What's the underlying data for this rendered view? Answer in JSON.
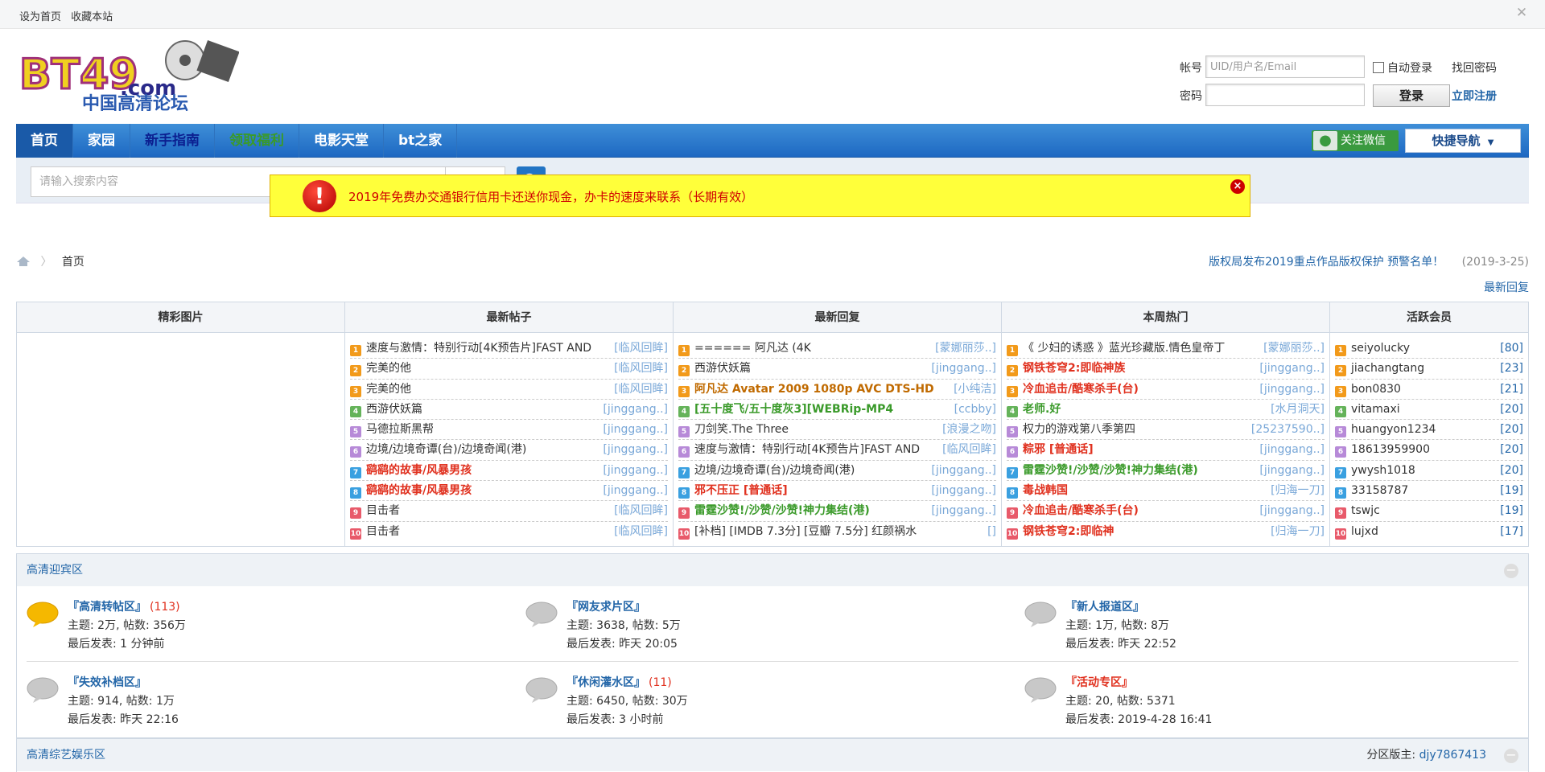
{
  "topbar": {
    "set_home": "设为首页",
    "bookmark": "收藏本站"
  },
  "logo": {
    "text": "BT49",
    "domain": ".com",
    "subtitle": "中国高清论坛"
  },
  "login": {
    "account_label": "帐号",
    "account_placeholder": "UID/用户名/Email",
    "auto_login": "自动登录",
    "find_password": "找回密码",
    "password_label": "密码",
    "login_button": "登录",
    "register": "立即注册"
  },
  "nav": {
    "items": [
      "首页",
      "家园",
      "新手指南",
      "领取福利",
      "电影天堂",
      "bt之家"
    ],
    "wechat": "关注微信",
    "quick_nav": "快捷导航"
  },
  "search": {
    "placeholder": "请输入搜索内容",
    "type": "搜索"
  },
  "notice": {
    "text": "2019年免费办交通银行信用卡还送你现金，办卡的速度来联系（长期有效）",
    "color": "#d00000",
    "background": "#ffff3a"
  },
  "breadcrumb": {
    "home": "首页"
  },
  "announcement": {
    "text": "版权局发布2019重点作品版权保护 预警名单！",
    "date": "(2019-3-25)"
  },
  "latest_reply_link": "最新回复",
  "grid": {
    "headers": [
      "精彩图片",
      "最新帖子",
      "最新回复",
      "本周热门",
      "活跃会员"
    ],
    "rank_colors": [
      "#f29a1a",
      "#f29a1a",
      "#f29a1a",
      "#65b35a",
      "#b78ad8",
      "#b78ad8",
      "#3aa0e0",
      "#3aa0e0",
      "#e85a6a",
      "#e85a6a"
    ],
    "new_posts": [
      {
        "title": "速度与激情：特别行动[4K预告片]FAST AND",
        "author": "[临风回眸]",
        "style": ""
      },
      {
        "title": "完美的他",
        "author": "[临风回眸]",
        "style": ""
      },
      {
        "title": "完美的他",
        "author": "[临风回眸]",
        "style": ""
      },
      {
        "title": "西游伏妖篇",
        "author": "[jinggang..]",
        "style": ""
      },
      {
        "title": "马德拉斯黑帮",
        "author": "[jinggang..]",
        "style": ""
      },
      {
        "title": "边境/边境奇谭(台)/边境奇闻(港)",
        "author": "[jinggang..]",
        "style": ""
      },
      {
        "title": "鹞鹞的故事/风暴男孩",
        "author": "[jinggang..]",
        "style": "red"
      },
      {
        "title": "鹞鹞的故事/风暴男孩",
        "author": "[jinggang..]",
        "style": "red"
      },
      {
        "title": "目击者",
        "author": "[临风回眸]",
        "style": ""
      },
      {
        "title": "目击者",
        "author": "[临风回眸]",
        "style": ""
      }
    ],
    "new_replies": [
      {
        "title": "====== 阿凡达 (4K",
        "author": "[蒙娜丽莎..]",
        "style": ""
      },
      {
        "title": "西游伏妖篇",
        "author": "[jinggang..]",
        "style": ""
      },
      {
        "title": "阿凡达 Avatar 2009 1080p AVC DTS-HD",
        "author": "[小纯洁]",
        "style": "brown"
      },
      {
        "title": "[五十度飞/五十度灰3][WEBRip-MP4",
        "author": "[ccbby]",
        "style": "green"
      },
      {
        "title": "刀剑笑.The Three",
        "author": "[浪漫之吻]",
        "style": ""
      },
      {
        "title": "速度与激情：特别行动[4K预告片]FAST AND",
        "author": "[临风回眸]",
        "style": ""
      },
      {
        "title": "边境/边境奇谭(台)/边境奇闻(港)",
        "author": "[jinggang..]",
        "style": ""
      },
      {
        "title": "邪不压正 [普通话]",
        "author": "[jinggang..]",
        "style": "red"
      },
      {
        "title": "雷霆沙赞!/沙赞/沙赞!神力集结(港)",
        "author": "[jinggang..]",
        "style": "green"
      },
      {
        "title": "[补档] [IMDB 7.3分] [豆瓣 7.5分] 红颜祸水",
        "author": "[]",
        "style": ""
      }
    ],
    "weekly_hot": [
      {
        "title": "《 少妇的诱惑 》蓝光珍藏版.情色皇帝丁",
        "author": "[蒙娜丽莎..]",
        "style": ""
      },
      {
        "title": "钢铁苍穹2:即临神族",
        "author": "[jinggang..]",
        "style": "red"
      },
      {
        "title": "冷血追击/酷寒杀手(台)",
        "author": "[jinggang..]",
        "style": "red"
      },
      {
        "title": "老师.好",
        "author": "[水月洞天]",
        "style": "green"
      },
      {
        "title": "权力的游戏第八季第四",
        "author": "[25237590..]",
        "style": ""
      },
      {
        "title": "粽邪 [普通话]",
        "author": "[jinggang..]",
        "style": "red"
      },
      {
        "title": "雷霆沙赞!/沙赞/沙赞!神力集结(港)",
        "author": "[jinggang..]",
        "style": "green"
      },
      {
        "title": "毒战韩国",
        "author": "[归海一刀]",
        "style": "red"
      },
      {
        "title": "冷血追击/酷寒杀手(台)",
        "author": "[jinggang..]",
        "style": "red"
      },
      {
        "title": "钢铁苍穹2:即临神",
        "author": "[归海一刀]",
        "style": "red"
      }
    ],
    "active_members": [
      {
        "name": "seiyolucky",
        "count": "[80]"
      },
      {
        "name": "jiachangtang",
        "count": "[23]"
      },
      {
        "name": "bon0830",
        "count": "[21]"
      },
      {
        "name": "vitamaxi",
        "count": "[20]"
      },
      {
        "name": "huangyon1234",
        "count": "[20]"
      },
      {
        "name": "18613959900",
        "count": "[20]"
      },
      {
        "name": "ywysh1018",
        "count": "[20]"
      },
      {
        "name": "33158787",
        "count": "[19]"
      },
      {
        "name": "tswjc",
        "count": "[19]"
      },
      {
        "name": "lujxd",
        "count": "[17]"
      }
    ]
  },
  "section1": {
    "title": "高清迎宾区",
    "forums": [
      {
        "name": "『高清转帖区』",
        "count": "(113)",
        "stats": "主题: 2万, 帖数: 356万",
        "last": "最后发表: 1 分钟前",
        "new": true,
        "red": false
      },
      {
        "name": "『网友求片区』",
        "count": "",
        "stats": "主题: 3638, 帖数: 5万",
        "last": "最后发表: 昨天 20:05",
        "new": false,
        "red": false
      },
      {
        "name": "『新人报道区』",
        "count": "",
        "stats": "主题: 1万, 帖数: 8万",
        "last": "最后发表: 昨天 22:52",
        "new": false,
        "red": false
      },
      {
        "name": "『失效补档区』",
        "count": "",
        "stats": "主题: 914, 帖数: 1万",
        "last": "最后发表: 昨天 22:16",
        "new": false,
        "red": false
      },
      {
        "name": "『休闲灌水区』",
        "count": "(11)",
        "stats": "主题: 6450, 帖数: 30万",
        "last": "最后发表: 3 小时前",
        "new": false,
        "red": false
      },
      {
        "name": "『活动专区』",
        "count": "",
        "stats": "主题: 20, 帖数: 5371",
        "last": "最后发表: 2019-4-28 16:41",
        "new": false,
        "red": true
      }
    ]
  },
  "section2": {
    "title": "高清综艺娱乐区",
    "moderator_label": "分区版主:",
    "moderator": "djy7867413"
  }
}
